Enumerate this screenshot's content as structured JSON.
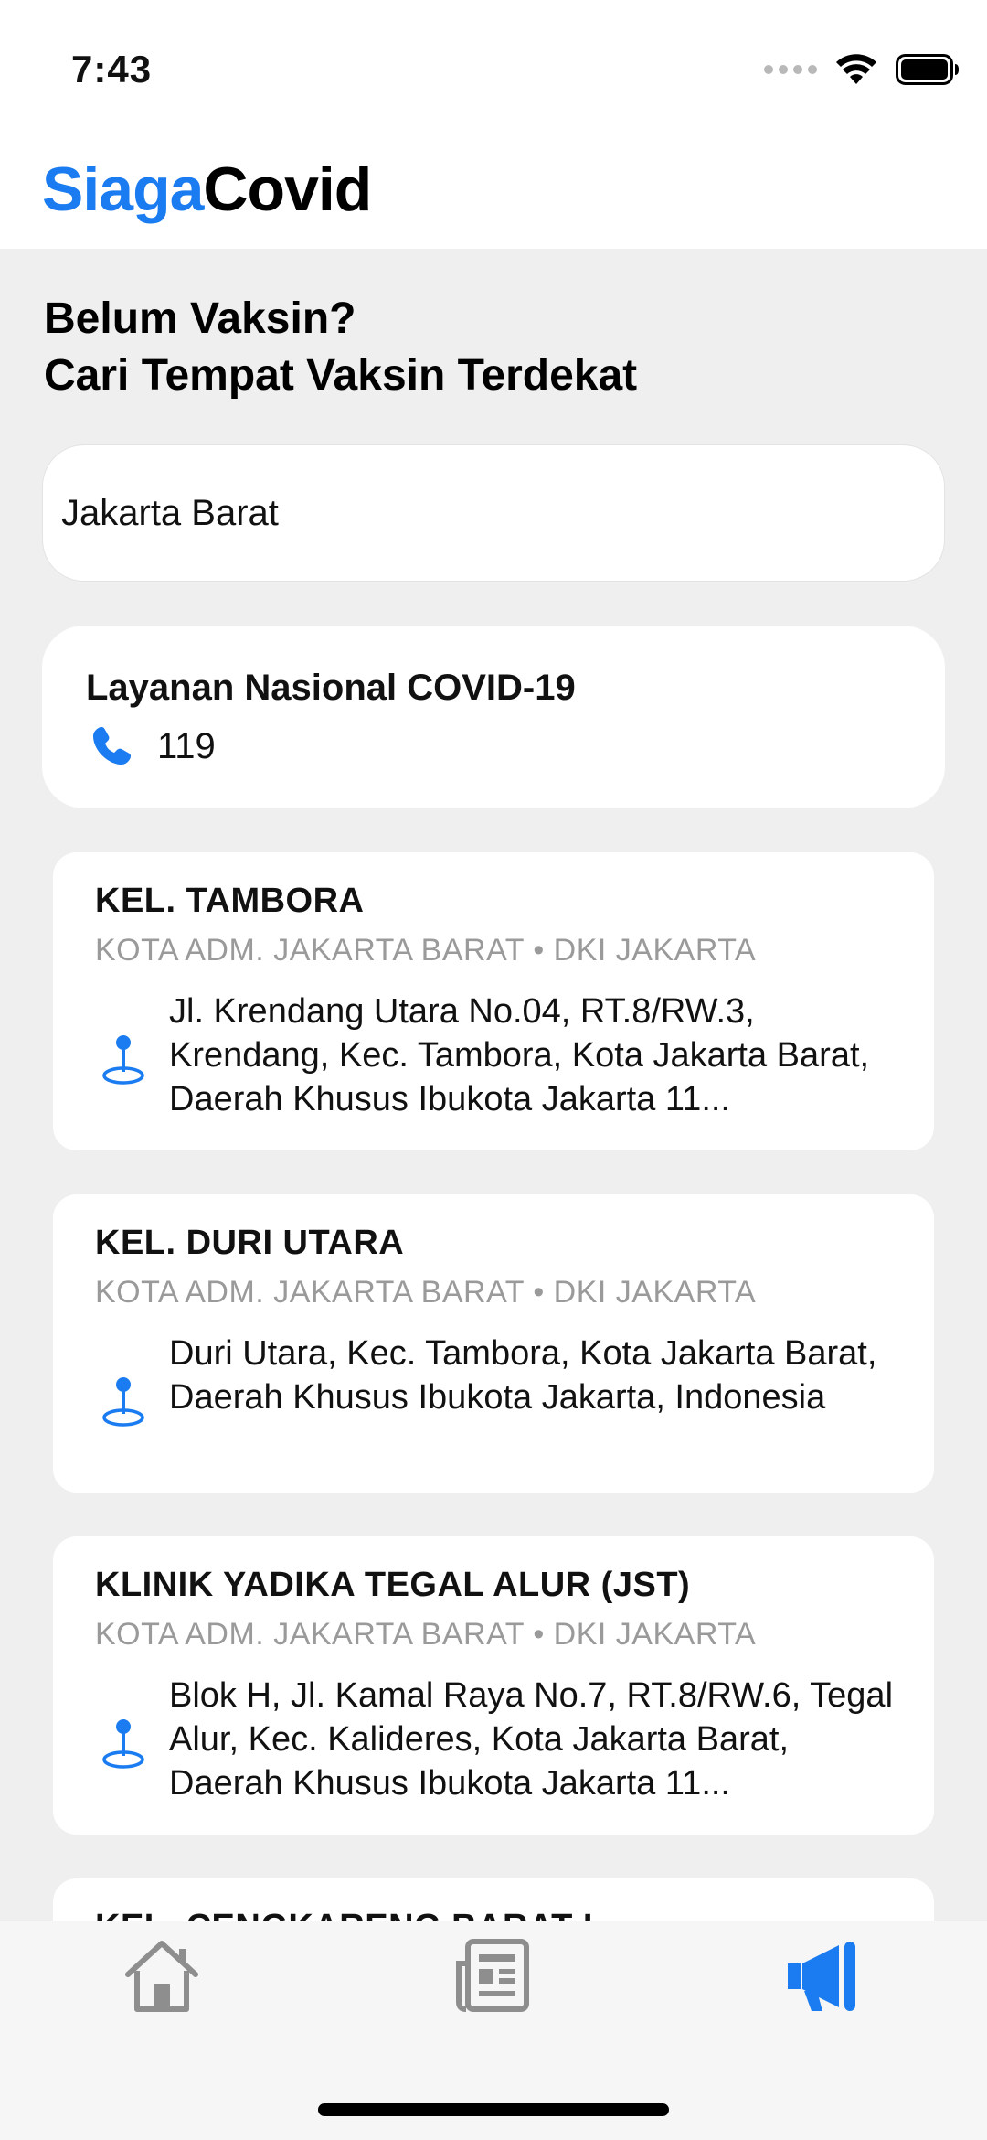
{
  "status": {
    "time": "7:43"
  },
  "header": {
    "title_accent": "Siaga",
    "title_rest": "Covid"
  },
  "section": {
    "heading_line1": "Belum Vaksin?",
    "heading_line2": "Cari Tempat Vaksin Terdekat"
  },
  "search": {
    "value": "Jakarta Barat"
  },
  "hotline": {
    "title": "Layanan Nasional COVID-19",
    "number": "119"
  },
  "places": [
    {
      "name": "KEL. TAMBORA",
      "region": "KOTA ADM. JAKARTA BARAT • DKI JAKARTA",
      "address": "Jl. Krendang Utara No.04, RT.8/RW.3, Krendang, Kec. Tambora, Kota Jakarta Barat, Daerah Khusus Ibukota Jakarta 11..."
    },
    {
      "name": "KEL. DURI UTARA",
      "region": "KOTA ADM. JAKARTA BARAT • DKI JAKARTA",
      "address": "Duri Utara, Kec. Tambora, Kota Jakarta Barat, Daerah Khusus Ibukota Jakarta, Indonesia"
    },
    {
      "name": "KLINIK YADIKA TEGAL ALUR (JST)",
      "region": "KOTA ADM. JAKARTA BARAT • DKI JAKARTA",
      "address": "Blok H, Jl. Kamal Raya No.7, RT.8/RW.6, Tegal Alur, Kec. Kalideres, Kota Jakarta Barat, Daerah Khusus Ibukota Jakarta 11..."
    },
    {
      "name": "KEL. CENGKARENG BARAT I",
      "region": "",
      "address": ""
    }
  ],
  "tabs": [
    {
      "icon": "home-icon",
      "active": false
    },
    {
      "icon": "newspaper-icon",
      "active": false
    },
    {
      "icon": "megaphone-icon",
      "active": true
    }
  ],
  "colors": {
    "accent": "#1a7cf0",
    "background": "#efefef",
    "card": "#ffffff",
    "muted": "#9a9a9a",
    "tab_inactive": "#8e8e8e"
  }
}
